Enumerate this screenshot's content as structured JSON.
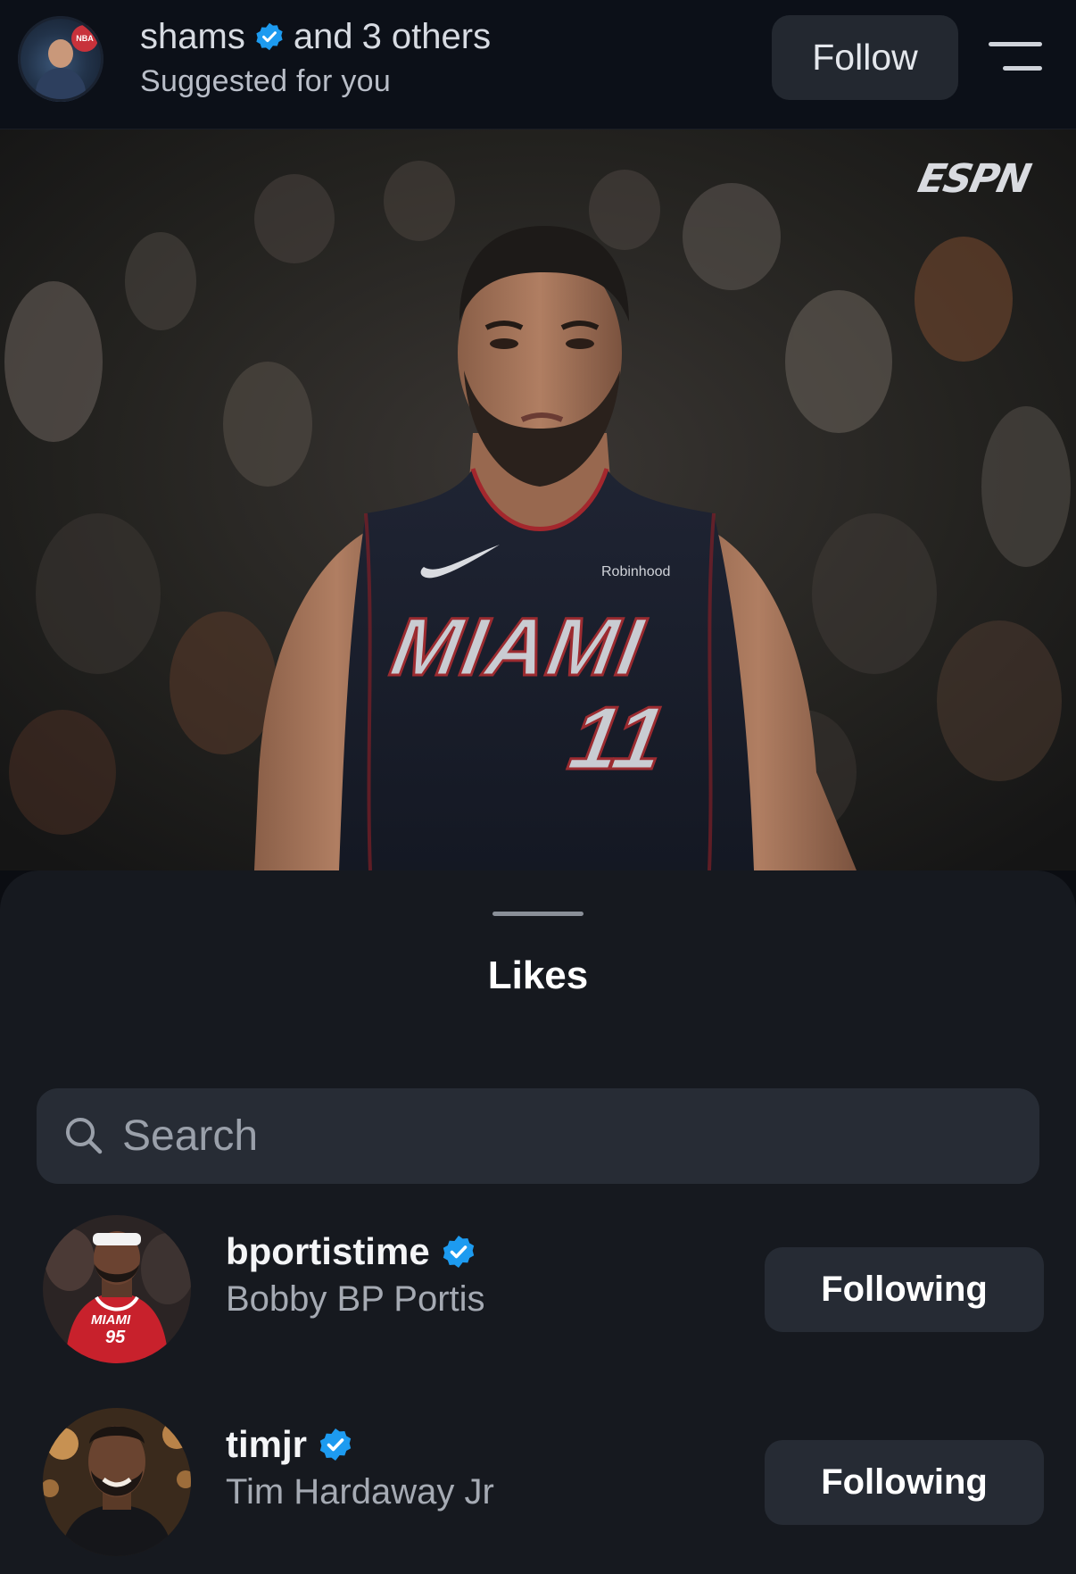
{
  "header": {
    "username": "shams",
    "and_text": "and",
    "others_text": "3 others",
    "subtitle": "Suggested for you",
    "follow_label": "Follow",
    "avatar_badge": "NBA"
  },
  "post": {
    "watermark": "ESPN",
    "jersey_sponsor": "Robinhood",
    "jersey_team": "MIAMI",
    "jersey_number": "11"
  },
  "likes_sheet": {
    "title": "Likes",
    "search": {
      "placeholder": "Search",
      "value": ""
    },
    "users": [
      {
        "handle": "bportistime",
        "full_name": "Bobby BP Portis",
        "verified": true,
        "button_label": "Following",
        "avatar_jersey_team": "MIAMI",
        "avatar_jersey_number": "95"
      },
      {
        "handle": "timjr",
        "full_name": "Tim Hardaway Jr",
        "verified": true,
        "button_label": "Following"
      }
    ]
  },
  "colors": {
    "verified_blue": "#1d9bf0",
    "sheet_bg": "#16191f",
    "button_bg": "#262b34",
    "heat_red": "#b3202a"
  },
  "icons": {
    "header_menu": "menu-lines-icon",
    "search": "search-icon",
    "verified": "verified-badge-icon"
  }
}
